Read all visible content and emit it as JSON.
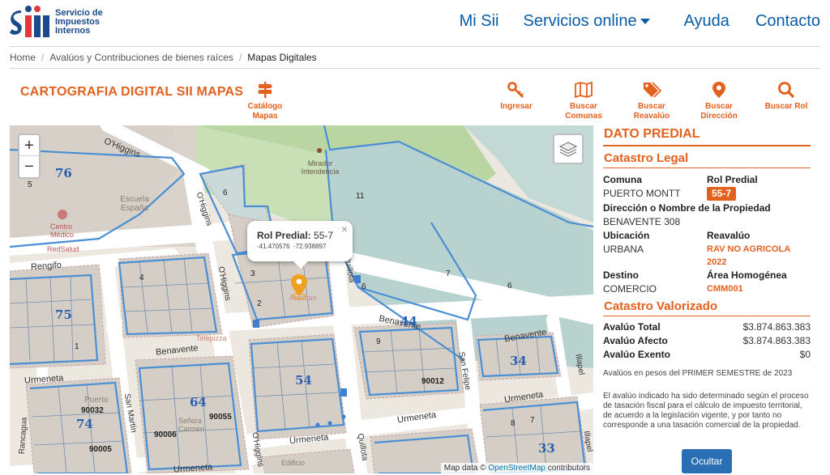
{
  "header": {
    "logo_text": [
      "Servicio de",
      "Impuestos",
      "Internos"
    ],
    "nav": {
      "mi_sii": "Mi Sii",
      "servicios": "Servicios online",
      "ayuda": "Ayuda",
      "contacto": "Contacto"
    }
  },
  "breadcrumb": {
    "home": "Home",
    "section": "Avalúos y Contribuciones de bienes raíces",
    "current": "Mapas Digitales"
  },
  "toolbar": {
    "title": "CARTOGRAFIA DIGITAL SII MAPAS",
    "catalogo": [
      "Catálogo",
      "Mapas"
    ],
    "ingresar": "Ingresar",
    "buscar_comunas": [
      "Buscar",
      "Comunas"
    ],
    "buscar_reavaluo": [
      "Buscar",
      "Reavalúo"
    ],
    "buscar_direccion": [
      "Buscar",
      "Dirección"
    ],
    "buscar_rol": "Buscar Rol"
  },
  "map": {
    "zoom_in": "+",
    "zoom_out": "−",
    "attribution_prefix": "Map data © ",
    "attribution_link": "OpenStreetMap",
    "attribution_suffix": " contributors",
    "popup": {
      "label": "Rol Predial:",
      "value": "55-7",
      "lat": "-41.470576",
      "lon": "-72.938897",
      "close": "×"
    },
    "streets": {
      "ohiggins_a": "O'Higgins",
      "ohiggins_b": "O'Higgins",
      "ohiggins_c": "O'Higgins",
      "ohiggins_d": "O'Higgins",
      "rengifo": "Rengifo",
      "benavente_a": "Benavente",
      "benavente_b": "Benavente",
      "benavente_c": "Benavente",
      "quillota_a": "Quillota",
      "quillota_b": "Quillota",
      "urmeneta_a": "Urmeneta",
      "urmeneta_b": "Urmeneta",
      "urmeneta_c": "Urmeneta",
      "urmeneta_d": "Urmeneta",
      "san_martin": "San Martín",
      "san_felipe": "San Felipe",
      "rancagua": "Rancagua",
      "illapel_a": "Illapel",
      "illapel_b": "Illapel"
    },
    "places": {
      "escuela": "Escuela España",
      "centro_medico": "Centro Médico",
      "redsalud": "RedSalud",
      "mirador": "Mirador Intendencia",
      "araucan": "Araucan",
      "telepizza": "Telepizza",
      "puerto": "Puerto",
      "carmen": "Señora Carmen",
      "edificio": "Edificio"
    },
    "blocks": [
      "76",
      "75",
      "74",
      "64",
      "54",
      "44",
      "34",
      "33"
    ],
    "lots": [
      "11",
      "7",
      "6",
      "90032",
      "90005",
      "90006",
      "90055",
      "90012",
      "1",
      "2",
      "3",
      "4",
      "5",
      "6",
      "7",
      "8",
      "9"
    ]
  },
  "panel": {
    "title": "DATO PREDIAL",
    "legal_title": "Catastro Legal",
    "comuna_label": "Comuna",
    "comuna_value": "PUERTO MONTT",
    "rol_label": "Rol Predial",
    "rol_value": "55-7",
    "direccion_label": "Dirección o Nombre de la Propiedad",
    "direccion_value": "BENAVENTE 308",
    "ubicacion_label": "Ubicación",
    "ubicacion_value": "URBANA",
    "reavaluo_label": "Reavalúo",
    "reavaluo_value": "RAV NO AGRICOLA",
    "reavaluo_year": "2022",
    "destino_label": "Destino",
    "destino_value": "COMERCIO",
    "area_label": "Área Homogénea",
    "area_value": "CMM001",
    "valorizado_title": "Catastro Valorizado",
    "avaluo_total_label": "Avalúo Total",
    "avaluo_total_value": "$3.874.863.383",
    "avaluo_afecto_label": "Avalúo Afecto",
    "avaluo_afecto_value": "$3.874.863.383",
    "avaluo_exento_label": "Avalúo Exento",
    "avaluo_exento_value": "$0",
    "note1": "Avalúos en pesos del PRIMER SEMESTRE de 2023",
    "note2": "El avalúo indicado ha sido determinado según el proceso de tasación fiscal para el cálculo de impuesto territorial, de acuerdo a la legislación vigente, y por tanto no corresponde a una tasación comercial de la propiedad.",
    "ocultar": "Ocultar"
  },
  "colors": {
    "accent": "#e2611e",
    "brand_blue": "#0b5ca8",
    "button_blue": "#2a6fb4",
    "parcel_line": "#4a8fd4"
  }
}
